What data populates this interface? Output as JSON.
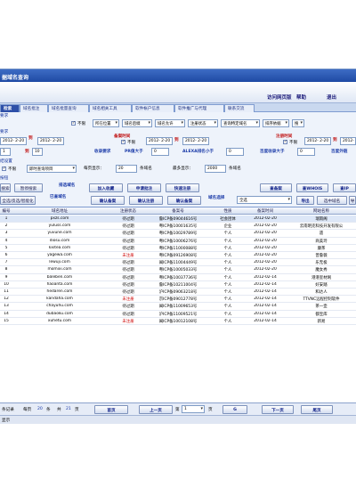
{
  "window": {
    "title": "据域名查询"
  },
  "menu": {
    "items": [
      "访问网页版",
      "帮助",
      "退出"
    ]
  },
  "tabs": [
    "检索",
    "域名批注",
    "域名批量查询",
    "域名相关工具",
    "软件帐户信息",
    "软件推广与代理",
    "联系交流"
  ],
  "filters": {
    "sec1": "要求",
    "no_limit_1": "不限",
    "status_sel": "所在位置",
    "dn_suffix_sel": "域名后缀",
    "dn_allow_sel": "域名允许",
    "reg_status_sel": "注册状态",
    "query_specific_sel": "查询特定域名",
    "sort_sel": "排序依据",
    "sort_extra": "搜",
    "sec2": "要求",
    "date_from": "2012- 2-20",
    "to1": "到",
    "date_to": "2012- 2-20",
    "record_time_label": "备案时间",
    "no_limit_2": "不限",
    "rec_from": "2012- 2-20",
    "rec_to": "2012- 2-20",
    "reg_time_label": "注册时间",
    "no_limit_3": "不限",
    "reg_from": "2012- 2-20",
    "reg_to": "2012- 2-20",
    "len_from": "1",
    "to2": "到",
    "len_to": "10",
    "record_req": "收录要求",
    "pr_label": "PR值大于",
    "pr_val": "0",
    "alexa_label": "ALEXA排名小于",
    "alexa_val": "0",
    "baidu_label": "百度收录大于",
    "baidu_val": "0",
    "baidu_ext_label": "百度外链",
    "sec3": "结设置",
    "no_limit_4": "不限",
    "query_opt": "即时查询项目",
    "per_page_label": "每页显示：",
    "per_page_val": "20",
    "per_page_unit": "条域名",
    "max_label": "最多显示：",
    "max_val": "2000",
    "max_unit": "条域名",
    "sec4": "按钮"
  },
  "buttons": {
    "start": "搜索",
    "pause": "暂停搜索",
    "exclude_label": "排选域名",
    "add_favorite": "加入收藏",
    "apply_annotate": "申请批注",
    "quick_reg": "快速注册",
    "check_record": "查备案",
    "check_whois": "查WHOIS",
    "check_ip": "查IP",
    "select_all": "全选/反选/智能化",
    "selected_label": "已查域名",
    "confirm_record": "确认备案",
    "confirm_reg": "确认注册",
    "confirm_record2": "确认备案",
    "domain_choose_label": "域名选择",
    "domain_choose_val": "全选",
    "export": "导出",
    "select_domain": "选中域名",
    "extra": "导"
  },
  "table": {
    "headers": [
      "编号",
      "域名地址",
      "注册状态",
      "备案号",
      "性质",
      "备案时间",
      "网站名称"
    ],
    "rows": [
      [
        "1",
        "pxzs.com",
        "待过期",
        "鲁ICP备09044616号",
        "社会团体",
        "2012-02-20",
        "瑞雨阁"
      ],
      [
        "2",
        "yuluss.com",
        "待过期",
        "粤ICP备10001635号",
        "企业",
        "2012-02-20",
        "云南明克科技开发有限公"
      ],
      [
        "3",
        "yuvune.com",
        "待过期",
        "粤ICP备10029789号",
        "个人",
        "2012-02-20",
        "遗"
      ],
      [
        "4",
        "diosu.com",
        "待过期",
        "粤ICP备10006276号",
        "个人",
        "2012-02-20",
        "商美玲"
      ],
      [
        "5",
        "kxitea.com",
        "待过期",
        "粤ICP备11000088号",
        "个人",
        "2012-02-20",
        "康茶"
      ],
      [
        "6",
        "yagewa.com",
        "未注册",
        "粤ICP备09126908号",
        "个人",
        "2012-02-20",
        "普鲁薇"
      ],
      [
        "7",
        "lewuji.com",
        "待过期",
        "闽ICP备11004449号",
        "个人",
        "2012-02-20",
        "乐无极"
      ],
      [
        "8",
        "momixi.com",
        "待过期",
        "粤ICP备10005033号",
        "个人",
        "2012-02-20",
        "魔女秀"
      ],
      [
        "9",
        "baleben.com",
        "待过期",
        "粤ICP备10037736号",
        "个人",
        "2012-02-14",
        "港港室材网"
      ],
      [
        "10",
        "haoanta.com",
        "待过期",
        "鲁ICP备10211004号",
        "个人",
        "2012-02-14",
        "好安踏"
      ],
      [
        "11",
        "hedaren.com",
        "待过期",
        "沪ICP备09063218号",
        "个人",
        "2012-02-14",
        "和达人"
      ],
      [
        "12",
        "kandaha.com",
        "未注册",
        "京ICP备09012778号",
        "个人",
        "2012-02-14",
        "TTVNC远程控制软件"
      ],
      [
        "13",
        "chayuhu.com",
        "待过期",
        "闽ICP备11009653号",
        "个人",
        "2012-02-14",
        "茶一壶"
      ],
      [
        "14",
        "dubaoku.com",
        "待过期",
        "沪ICP备11009521号",
        "个人",
        "2012-02-14",
        "都宝库"
      ],
      [
        "15",
        "xuhetu.com",
        "未注册",
        "闽ICP备10012108号",
        "个人",
        "2012-02-14",
        "新易"
      ]
    ]
  },
  "pager": {
    "total_label": "条记录",
    "per_page_label": "每页",
    "per_page_val": "20",
    "per_page_unit": "条",
    "total_pages_label": "共",
    "total_pages_val": "21",
    "total_pages_unit": "页",
    "first": "首页",
    "prev": "上一页",
    "page_label": "第",
    "page_val": "1",
    "page_unit": "页",
    "go": "G",
    "next": "下一页",
    "last": "尾页"
  },
  "status": {
    "text": "显示"
  }
}
